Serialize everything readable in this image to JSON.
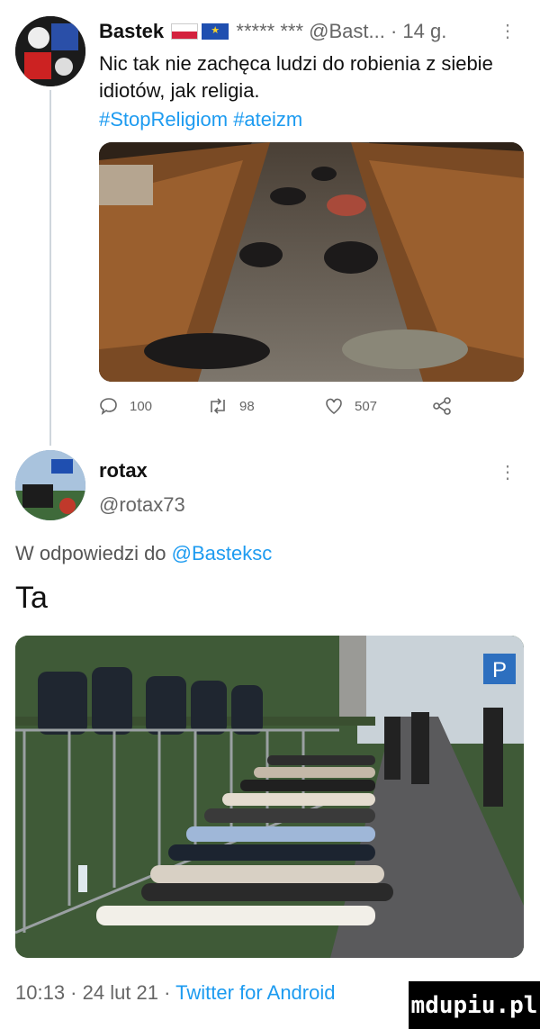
{
  "tweet1": {
    "name": "Bastek",
    "name_suffix": "***** ***",
    "handle": "@Bast...",
    "time": "· 14 g.",
    "more": "⋮",
    "text": "Nic tak nie zachęca ludzi do robienia z siebie idiotów, jak religia.",
    "hashtags": "#StopReligiom #ateizm",
    "stats": {
      "replies": "100",
      "retweets": "98",
      "likes": "507"
    }
  },
  "tweet2": {
    "name": "rotax",
    "handle": "@rotax73",
    "more": "⋮",
    "reply_prefix": "W odpowiedzi do",
    "reply_to": "@Basteksc",
    "text": "Ta",
    "meta_time": "10:13 · 24 lut 21 ·",
    "meta_client": "Twitter for Android"
  },
  "media2_labels": {
    "sign": "P"
  },
  "watermark": "mdupiu.pl",
  "colors": {
    "link": "#1d9bf0",
    "muted": "#666666",
    "text": "#111111"
  }
}
